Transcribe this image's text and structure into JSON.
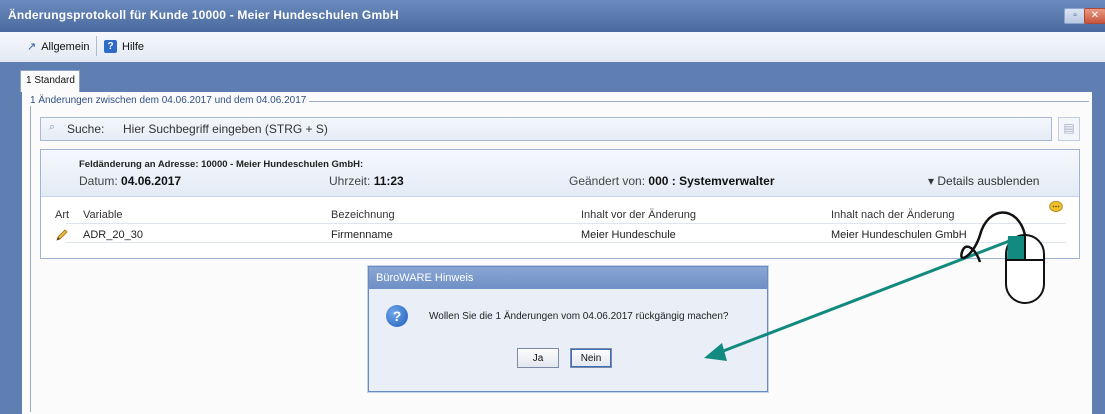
{
  "window": {
    "title": "Änderungsprotokoll für Kunde 10000 - Meier Hundeschulen GmbH",
    "minimize_glyph": "▫",
    "close_glyph": "✕"
  },
  "toolbar": {
    "general_label": "Allgemein",
    "general_icon": "arrow-up-right-icon",
    "help_label": "Hilfe",
    "help_icon": "question-icon"
  },
  "tabs": [
    {
      "label": "1 Standard",
      "active": true
    }
  ],
  "group": {
    "label": "1 Änderungen zwischen dem 04.06.2017 und dem 04.06.2017"
  },
  "search": {
    "label": "Suche:",
    "placeholder": "Hier Suchbegriff eingeben (STRG + S)"
  },
  "change": {
    "title": "Feldänderung an Adresse: 10000 - Meier Hundeschulen GmbH:",
    "date_label": "Datum:",
    "date_value": "04.06.2017",
    "time_label": "Uhrzeit:",
    "time_value": "11:23",
    "changed_by_label": "Geändert von:",
    "changed_by_value": "000 : Systemverwalter",
    "details_toggle": "▾ Details ausblenden"
  },
  "table": {
    "columns": [
      "Art",
      "Variable",
      "Bezeichnung",
      "Inhalt vor der Änderung",
      "Inhalt nach der Änderung"
    ],
    "rows": [
      {
        "art_icon": "pencil-icon",
        "variable": "ADR_20_30",
        "bezeichnung": "Firmenname",
        "before": "Meier Hundeschule",
        "after": "Meier Hundeschulen GmbH"
      }
    ]
  },
  "dialog": {
    "title": "BüroWARE Hinweis",
    "icon": "question-icon",
    "message": "Wollen Sie die 1 Änderungen vom 04.06.2017 rückgängig machen?",
    "yes_label": "Ja",
    "no_label": "Nein"
  },
  "colors": {
    "title_bar": "#5a79ae",
    "accent_arrow": "#138a80",
    "dialog_title": "#7c9acd"
  }
}
